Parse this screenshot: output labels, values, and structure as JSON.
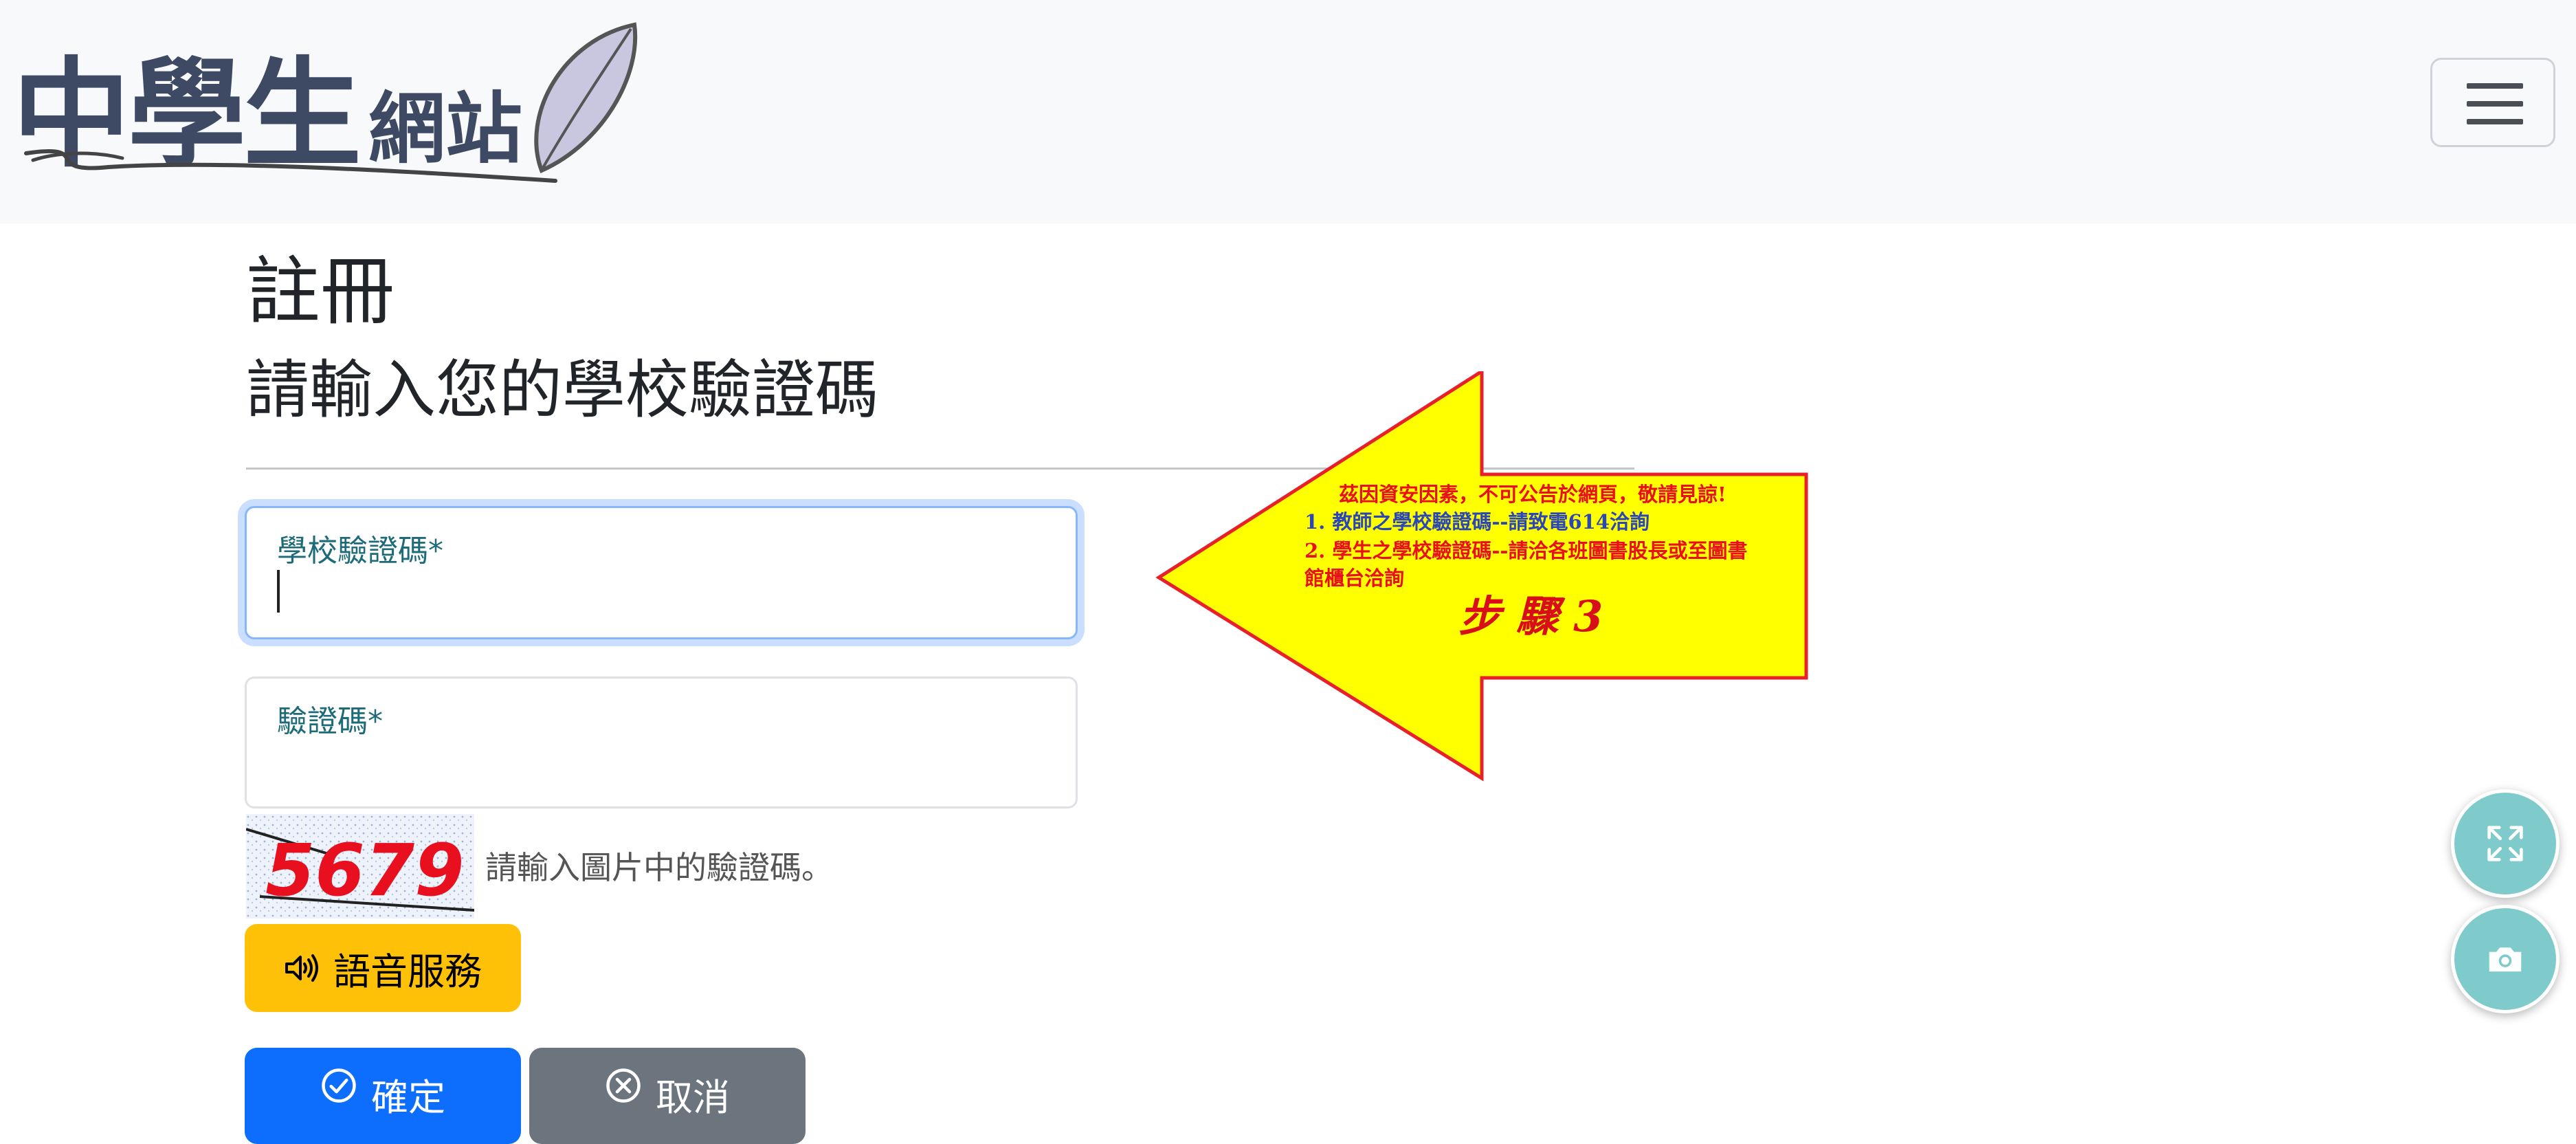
{
  "header": {
    "logo_main": "中學生",
    "logo_sub": "網站"
  },
  "page": {
    "title": "註冊",
    "subtitle": "請輸入您的學校驗證碼"
  },
  "form": {
    "school_code_label": "學校驗證碼*",
    "school_code_value": "",
    "captcha_label": "驗證碼*",
    "captcha_value": "",
    "captcha_image_text": "5679",
    "captcha_hint": "請輸入圖片中的驗證碼。"
  },
  "buttons": {
    "audio": "語音服務",
    "confirm": "確定",
    "cancel": "取消"
  },
  "annotation": {
    "line1": "茲因資安因素，不可公告於網頁，敬請見諒!",
    "line2": "1. 教師之學校驗證碼--請致電614洽詢",
    "line3": "2. 學生之學校驗證碼--請洽各班圖書股長或至圖書",
    "line4": "館櫃台洽詢",
    "step": "步 驟 3"
  },
  "colors": {
    "primary": "#0d6efd",
    "warning": "#ffc107",
    "secondary": "#6c757d",
    "arrow_fill": "#ffff00",
    "arrow_stroke": "#e8202a",
    "fab": "#7fcacb"
  },
  "icons": {
    "menu": "hamburger-icon",
    "audio": "speaker-icon",
    "confirm": "check-circle-icon",
    "cancel": "x-circle-icon",
    "expand": "expand-icon",
    "camera": "camera-icon",
    "logo_decoration": "feather-quill-icon"
  }
}
